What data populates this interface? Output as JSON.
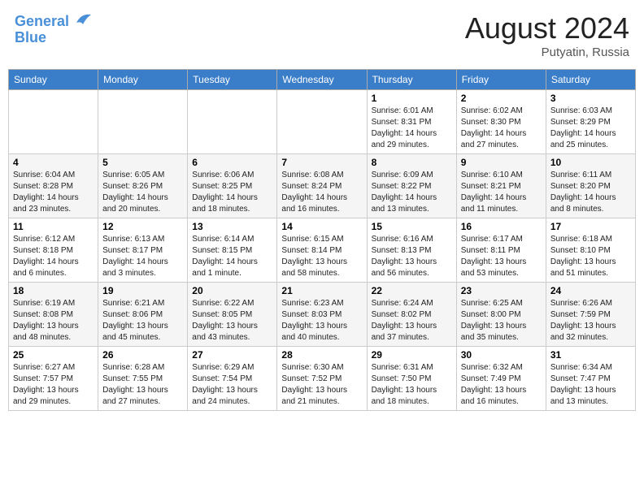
{
  "header": {
    "logo_line1": "General",
    "logo_line2": "Blue",
    "month_title": "August 2024",
    "location": "Putyatin, Russia"
  },
  "weekdays": [
    "Sunday",
    "Monday",
    "Tuesday",
    "Wednesday",
    "Thursday",
    "Friday",
    "Saturday"
  ],
  "weeks": [
    [
      {
        "day": "",
        "info": ""
      },
      {
        "day": "",
        "info": ""
      },
      {
        "day": "",
        "info": ""
      },
      {
        "day": "",
        "info": ""
      },
      {
        "day": "1",
        "info": "Sunrise: 6:01 AM\nSunset: 8:31 PM\nDaylight: 14 hours\nand 29 minutes."
      },
      {
        "day": "2",
        "info": "Sunrise: 6:02 AM\nSunset: 8:30 PM\nDaylight: 14 hours\nand 27 minutes."
      },
      {
        "day": "3",
        "info": "Sunrise: 6:03 AM\nSunset: 8:29 PM\nDaylight: 14 hours\nand 25 minutes."
      }
    ],
    [
      {
        "day": "4",
        "info": "Sunrise: 6:04 AM\nSunset: 8:28 PM\nDaylight: 14 hours\nand 23 minutes."
      },
      {
        "day": "5",
        "info": "Sunrise: 6:05 AM\nSunset: 8:26 PM\nDaylight: 14 hours\nand 20 minutes."
      },
      {
        "day": "6",
        "info": "Sunrise: 6:06 AM\nSunset: 8:25 PM\nDaylight: 14 hours\nand 18 minutes."
      },
      {
        "day": "7",
        "info": "Sunrise: 6:08 AM\nSunset: 8:24 PM\nDaylight: 14 hours\nand 16 minutes."
      },
      {
        "day": "8",
        "info": "Sunrise: 6:09 AM\nSunset: 8:22 PM\nDaylight: 14 hours\nand 13 minutes."
      },
      {
        "day": "9",
        "info": "Sunrise: 6:10 AM\nSunset: 8:21 PM\nDaylight: 14 hours\nand 11 minutes."
      },
      {
        "day": "10",
        "info": "Sunrise: 6:11 AM\nSunset: 8:20 PM\nDaylight: 14 hours\nand 8 minutes."
      }
    ],
    [
      {
        "day": "11",
        "info": "Sunrise: 6:12 AM\nSunset: 8:18 PM\nDaylight: 14 hours\nand 6 minutes."
      },
      {
        "day": "12",
        "info": "Sunrise: 6:13 AM\nSunset: 8:17 PM\nDaylight: 14 hours\nand 3 minutes."
      },
      {
        "day": "13",
        "info": "Sunrise: 6:14 AM\nSunset: 8:15 PM\nDaylight: 14 hours\nand 1 minute."
      },
      {
        "day": "14",
        "info": "Sunrise: 6:15 AM\nSunset: 8:14 PM\nDaylight: 13 hours\nand 58 minutes."
      },
      {
        "day": "15",
        "info": "Sunrise: 6:16 AM\nSunset: 8:13 PM\nDaylight: 13 hours\nand 56 minutes."
      },
      {
        "day": "16",
        "info": "Sunrise: 6:17 AM\nSunset: 8:11 PM\nDaylight: 13 hours\nand 53 minutes."
      },
      {
        "day": "17",
        "info": "Sunrise: 6:18 AM\nSunset: 8:10 PM\nDaylight: 13 hours\nand 51 minutes."
      }
    ],
    [
      {
        "day": "18",
        "info": "Sunrise: 6:19 AM\nSunset: 8:08 PM\nDaylight: 13 hours\nand 48 minutes."
      },
      {
        "day": "19",
        "info": "Sunrise: 6:21 AM\nSunset: 8:06 PM\nDaylight: 13 hours\nand 45 minutes."
      },
      {
        "day": "20",
        "info": "Sunrise: 6:22 AM\nSunset: 8:05 PM\nDaylight: 13 hours\nand 43 minutes."
      },
      {
        "day": "21",
        "info": "Sunrise: 6:23 AM\nSunset: 8:03 PM\nDaylight: 13 hours\nand 40 minutes."
      },
      {
        "day": "22",
        "info": "Sunrise: 6:24 AM\nSunset: 8:02 PM\nDaylight: 13 hours\nand 37 minutes."
      },
      {
        "day": "23",
        "info": "Sunrise: 6:25 AM\nSunset: 8:00 PM\nDaylight: 13 hours\nand 35 minutes."
      },
      {
        "day": "24",
        "info": "Sunrise: 6:26 AM\nSunset: 7:59 PM\nDaylight: 13 hours\nand 32 minutes."
      }
    ],
    [
      {
        "day": "25",
        "info": "Sunrise: 6:27 AM\nSunset: 7:57 PM\nDaylight: 13 hours\nand 29 minutes."
      },
      {
        "day": "26",
        "info": "Sunrise: 6:28 AM\nSunset: 7:55 PM\nDaylight: 13 hours\nand 27 minutes."
      },
      {
        "day": "27",
        "info": "Sunrise: 6:29 AM\nSunset: 7:54 PM\nDaylight: 13 hours\nand 24 minutes."
      },
      {
        "day": "28",
        "info": "Sunrise: 6:30 AM\nSunset: 7:52 PM\nDaylight: 13 hours\nand 21 minutes."
      },
      {
        "day": "29",
        "info": "Sunrise: 6:31 AM\nSunset: 7:50 PM\nDaylight: 13 hours\nand 18 minutes."
      },
      {
        "day": "30",
        "info": "Sunrise: 6:32 AM\nSunset: 7:49 PM\nDaylight: 13 hours\nand 16 minutes."
      },
      {
        "day": "31",
        "info": "Sunrise: 6:34 AM\nSunset: 7:47 PM\nDaylight: 13 hours\nand 13 minutes."
      }
    ]
  ]
}
